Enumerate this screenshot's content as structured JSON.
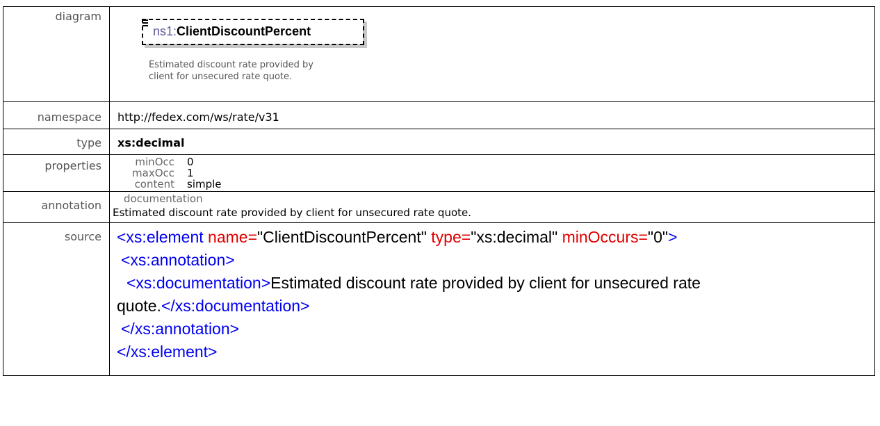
{
  "labels": {
    "diagram": "diagram",
    "namespace": "namespace",
    "type": "type",
    "properties": "properties",
    "annotation": "annotation",
    "source": "source"
  },
  "diagram": {
    "prefix": "ns1:",
    "element_name": "ClientDiscountPercent",
    "doc_line1": "Estimated discount rate provided by",
    "doc_line2": "client for unsecured rate quote."
  },
  "namespace": "http://fedex.com/ws/rate/v31",
  "type": "xs:decimal",
  "properties": [
    {
      "key": "minOcc",
      "value": "0"
    },
    {
      "key": "maxOcc",
      "value": "1"
    },
    {
      "key": "content",
      "value": "simple"
    }
  ],
  "annotation": {
    "key": "documentation",
    "text": "Estimated discount rate provided by client for unsecured rate quote."
  },
  "source": {
    "l1_open": "<xs:element ",
    "l1_attr1": "name=",
    "l1_val1": "\"ClientDiscountPercent\"",
    "l1_attr2": " type=",
    "l1_val2": "\"xs:decimal\"",
    "l1_attr3": " minOccurs=",
    "l1_val3": "\"0\"",
    "l1_close": ">",
    "l2": "<xs:annotation>",
    "l3_open": "<xs:documentation>",
    "l3_text": "Estimated discount rate provided by client for unsecured rate",
    "l4_text": "quote.",
    "l4_close": "</xs:documentation>",
    "l5": "</xs:annotation>",
    "l6": "</xs:element>"
  }
}
